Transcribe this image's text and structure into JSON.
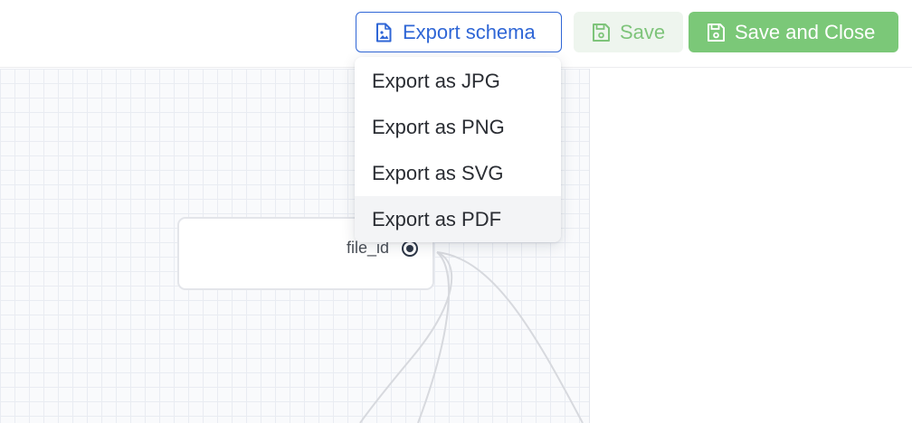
{
  "toolbar": {
    "export_label": "Export schema",
    "save_label": "Save",
    "save_close_label": "Save and Close",
    "export_icon": "file-image-icon",
    "save_icon": "floppy-disk-icon",
    "save_close_icon": "floppy-disk-icon"
  },
  "export_menu": {
    "items": [
      {
        "label": "Export as JPG"
      },
      {
        "label": "Export as PNG"
      },
      {
        "label": "Export as SVG"
      },
      {
        "label": "Export as PDF",
        "hovered": true
      }
    ]
  },
  "canvas": {
    "node": {
      "field": "file_id"
    }
  },
  "colors": {
    "accent_blue": "#2f66d6",
    "success_green": "#7bc878",
    "save_disabled_bg": "#eef5ee"
  }
}
